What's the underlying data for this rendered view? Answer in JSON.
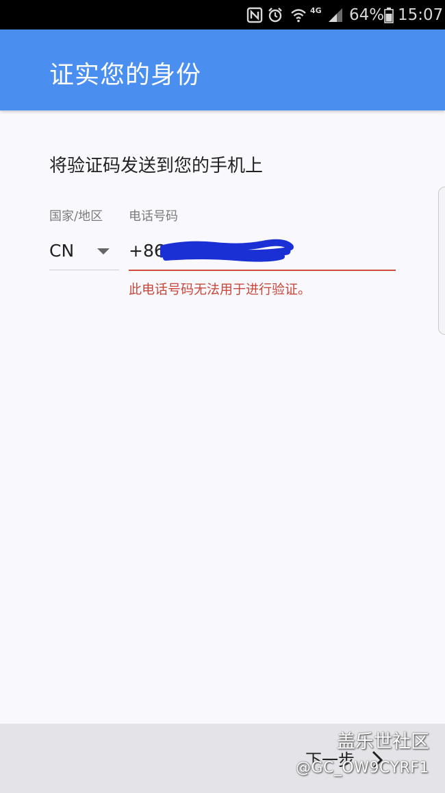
{
  "status_bar": {
    "battery_percent": "64%",
    "time": "15:07",
    "network": "4G",
    "icons": [
      "nfc-icon",
      "alarm-icon",
      "wifi-icon",
      "signal-icon",
      "battery-icon"
    ]
  },
  "app_bar": {
    "title": "证实您的身份",
    "color": "#4a8ef0"
  },
  "form": {
    "instruction": "将验证码发送到您的手机上",
    "country_label": "国家/地区",
    "phone_label": "电话号码",
    "country_value": "CN",
    "phone_value": "+861",
    "error_message": "此电话号码无法用于进行验证。",
    "error_color": "#c8473a"
  },
  "bottom_bar": {
    "next_label": "下一步"
  },
  "watermark": {
    "line1": "盖乐世社区",
    "line2": "@GC_OW9CYRF1"
  }
}
